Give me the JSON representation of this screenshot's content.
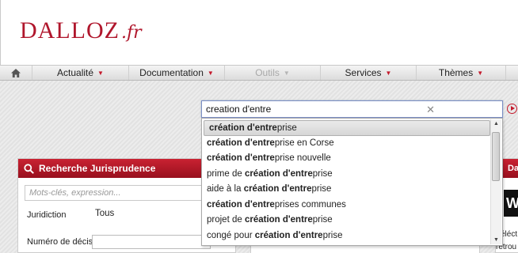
{
  "header": {
    "logo_text": "DALLOZ",
    "logo_suffix": ".fr"
  },
  "nav": {
    "items": [
      {
        "label": "Actualité",
        "disabled": false
      },
      {
        "label": "Documentation",
        "disabled": false
      },
      {
        "label": "Outils",
        "disabled": true
      },
      {
        "label": "Services",
        "disabled": false
      },
      {
        "label": "Thèmes",
        "disabled": false
      }
    ]
  },
  "search": {
    "value": "creation d'entre",
    "suggestions": [
      {
        "pre": "",
        "bold": "création d'entre",
        "post": "prise"
      },
      {
        "pre": "",
        "bold": "création d'entre",
        "post": "prise en Corse"
      },
      {
        "pre": "",
        "bold": "création d'entre",
        "post": "prise nouvelle"
      },
      {
        "pre": "prime de ",
        "bold": "création d'entre",
        "post": "prise"
      },
      {
        "pre": "aide à la ",
        "bold": "création d'entre",
        "post": "prise"
      },
      {
        "pre": "",
        "bold": "création d'entre",
        "post": "prises communes"
      },
      {
        "pre": "projet de ",
        "bold": "création d'entre",
        "post": "prise"
      },
      {
        "pre": "congé pour ",
        "bold": "création d'entre",
        "post": "prise"
      }
    ]
  },
  "jurisprudence": {
    "title": "Recherche Jurisprudence",
    "keywords_placeholder": "Mots-clés, expression...",
    "jurisdiction_label": "Juridiction",
    "jurisdiction_value": "Tous",
    "decision_number_label": "Numéro de décision"
  },
  "right_panel": {
    "title_fragment": "Da",
    "logo_letter": "W",
    "text_fragment_1": "séléct",
    "text_fragment_2": "retrou"
  },
  "colors": {
    "brand_red": "#b0162c",
    "nav_caret": "#c41a2c"
  }
}
